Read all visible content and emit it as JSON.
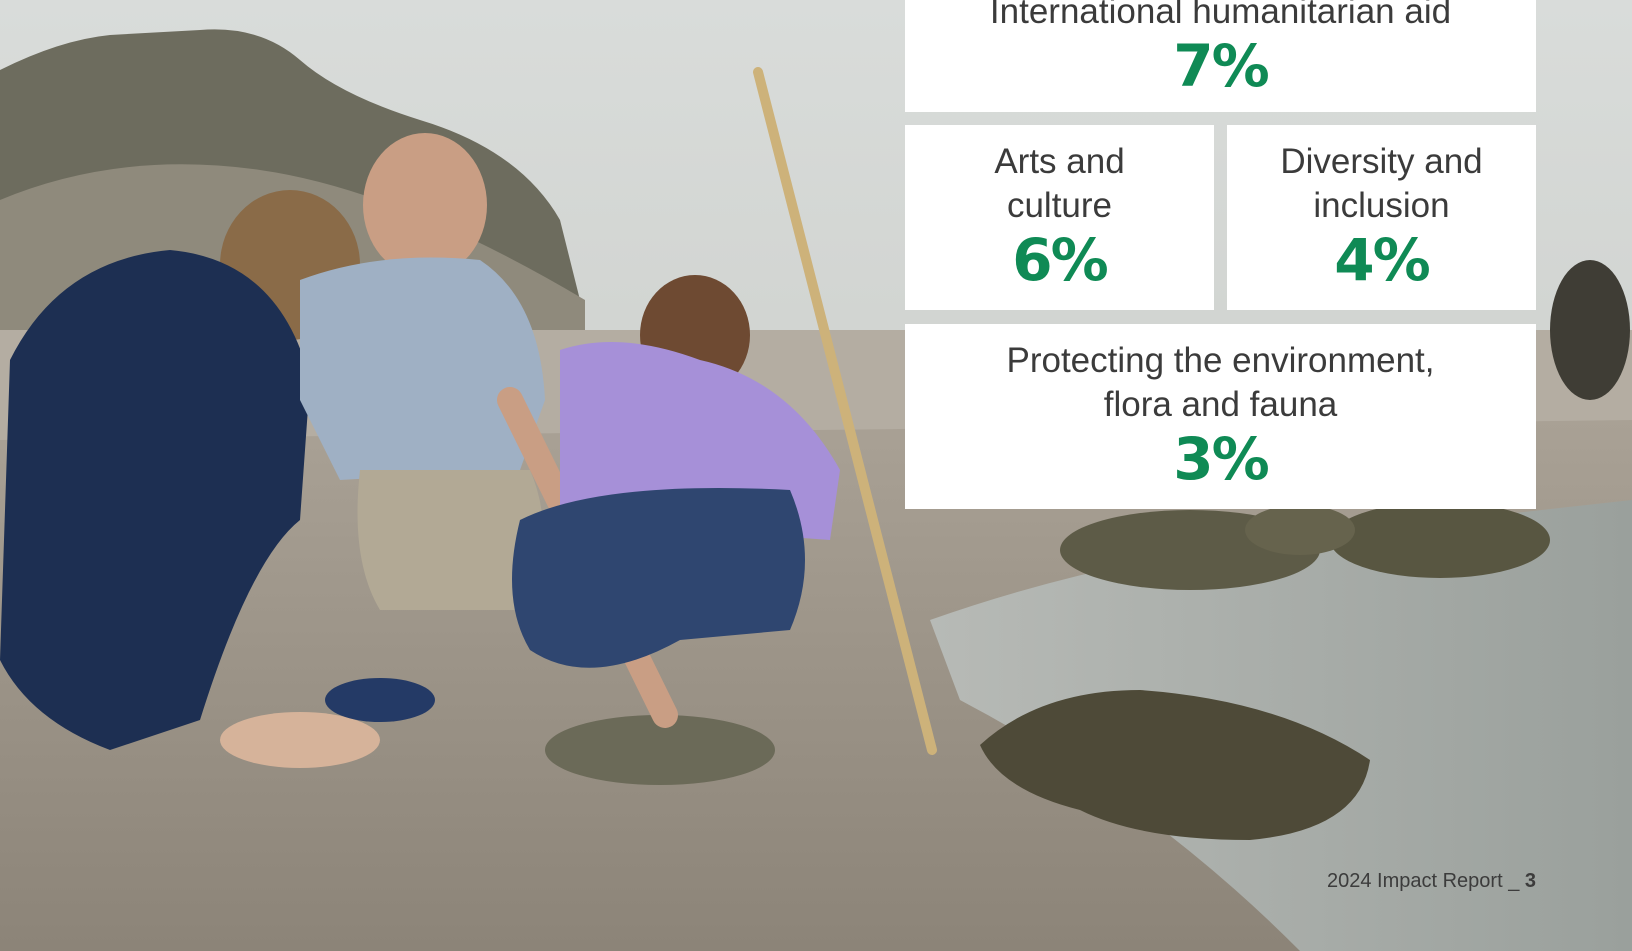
{
  "colors": {
    "accent": "#0f8a55",
    "card_bg": "#ffffff",
    "text": "#3b3b3b"
  },
  "cards": [
    {
      "label": "International humanitarian aid",
      "value": "7%"
    },
    {
      "label_lines": [
        "Arts and",
        "culture"
      ],
      "value": "6%"
    },
    {
      "label_lines": [
        "Diversity and",
        "inclusion"
      ],
      "value": "4%"
    },
    {
      "label_lines": [
        "Protecting the environment,",
        "flora and fauna"
      ],
      "value": "3%"
    }
  ],
  "footer": {
    "report": "2024 Impact Report _ ",
    "page": "3"
  }
}
